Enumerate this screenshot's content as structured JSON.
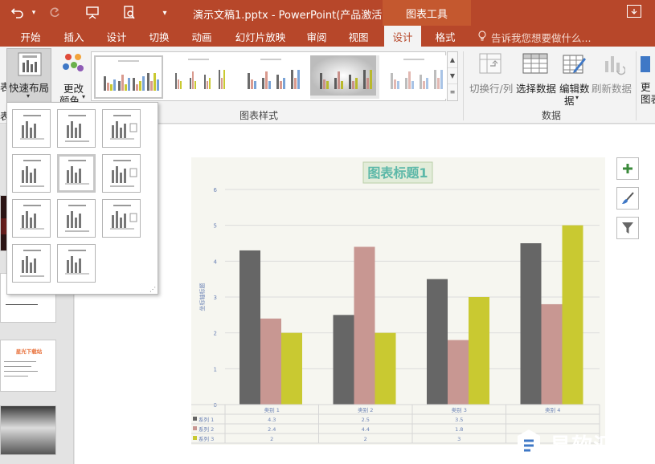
{
  "titlebar": {
    "document_title": "演示文稿1.pptx - PowerPoint(产品激活...",
    "context_tab": "图表工具",
    "bg_color": "#b7472a"
  },
  "tabs": [
    {
      "label": "开始"
    },
    {
      "label": "插入"
    },
    {
      "label": "设计"
    },
    {
      "label": "切换"
    },
    {
      "label": "动画"
    },
    {
      "label": "幻灯片放映"
    },
    {
      "label": "审阅"
    },
    {
      "label": "视图"
    },
    {
      "label": "设计",
      "active": true
    },
    {
      "label": "格式"
    }
  ],
  "tell_me": "告诉我您想要做什么...",
  "ribbon": {
    "quick_layout": "快速布局",
    "change_colors_1": "更改",
    "change_colors_2": "颜色",
    "chart_styles_group": "图表样式",
    "switch_row_col": "切换行/列",
    "select_data": "选择数据",
    "edit_data_1": "编辑数",
    "edit_data_2": "据",
    "refresh_data": "刷新数据",
    "data_group": "数据",
    "left_clip_1": "表",
    "left_clip_2": "表",
    "right_clip_1": "更",
    "right_clip_2": "图表"
  },
  "slides": {
    "thumb_title": "星光下载站"
  },
  "chart_data": {
    "type": "bar",
    "title": "图表标题1",
    "ylabel": "坐标轴标题",
    "xlabel": "",
    "categories": [
      "类别 1",
      "类别 2",
      "类别 3",
      "类别 4"
    ],
    "ylim": [
      0,
      6
    ],
    "yticks": [
      "0",
      "1",
      "2",
      "3",
      "4",
      "5",
      "6"
    ],
    "grid": true,
    "series": [
      {
        "name": "系列 1",
        "values": [
          4.3,
          2.5,
          3.5,
          4.5
        ],
        "color": "#666666"
      },
      {
        "name": "系列 2",
        "values": [
          2.4,
          4.4,
          1.8,
          2.8
        ],
        "color": "#c89792"
      },
      {
        "name": "系列 3",
        "values": [
          2,
          2,
          3,
          5
        ],
        "color": "#c9c931"
      }
    ],
    "table_rows": [
      {
        "name": "系列 1",
        "cells": [
          "4.3",
          "2.5",
          "3.5",
          ""
        ]
      },
      {
        "name": "系列 2",
        "cells": [
          "2.4",
          "4.4",
          "1.8",
          ""
        ]
      },
      {
        "name": "系列 3",
        "cells": [
          "2",
          "2",
          "3",
          ""
        ]
      }
    ]
  },
  "side_buttons": [
    "plus-icon",
    "brush-icon",
    "filter-icon"
  ],
  "watermark": {
    "text": "易软汇"
  }
}
